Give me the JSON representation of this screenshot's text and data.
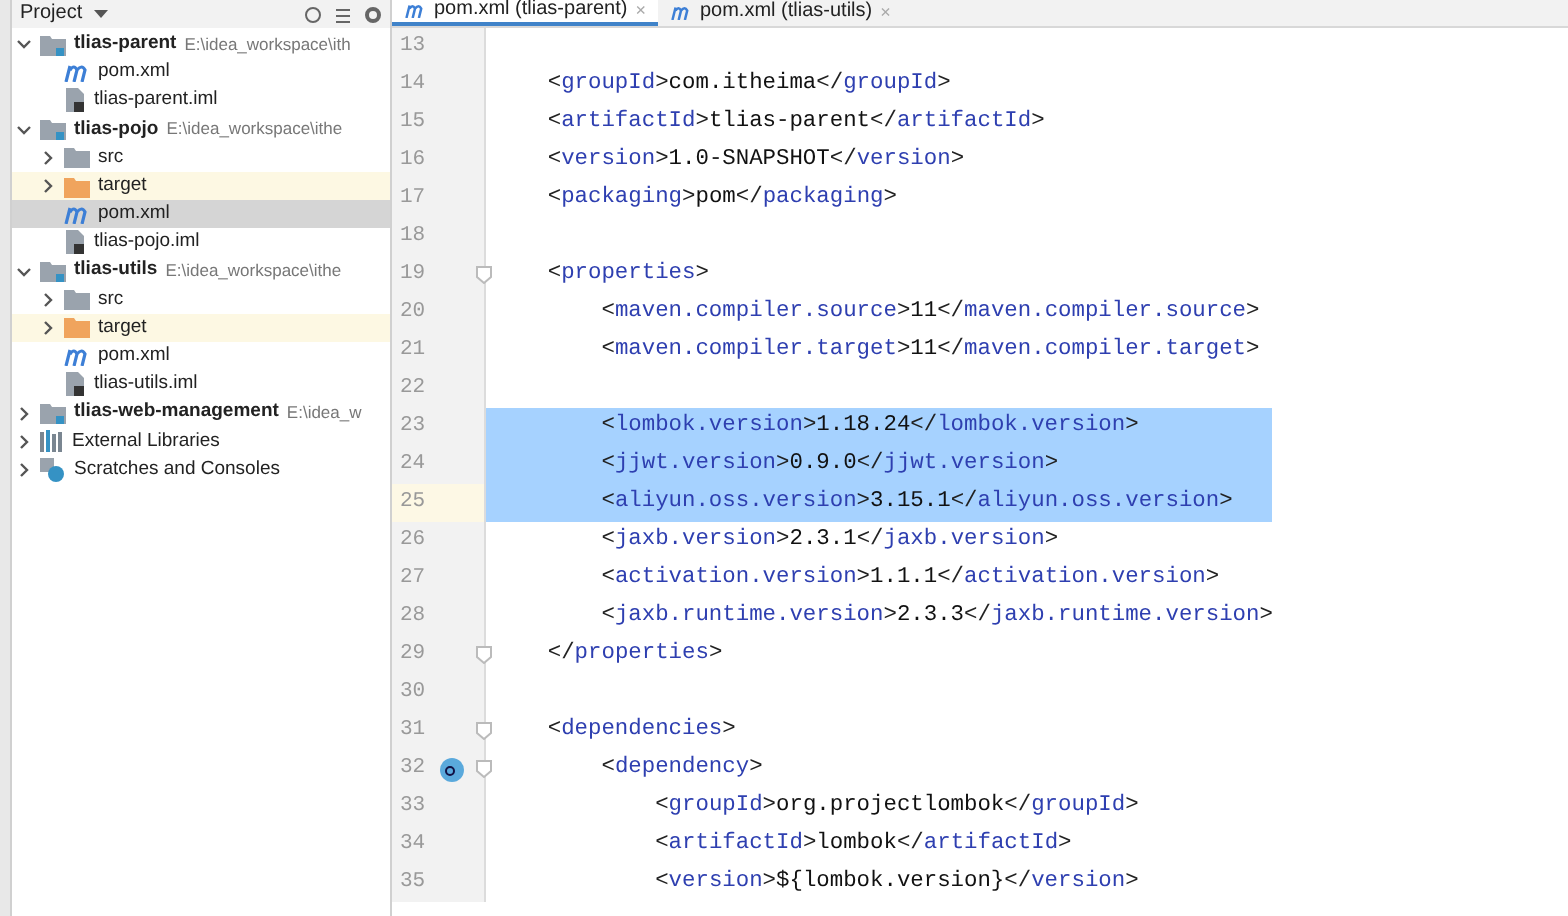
{
  "project_panel": {
    "title": "Project",
    "tree": [
      {
        "kind": "module",
        "label": "tlias-parent",
        "path": "E:\\idea_workspace\\ith",
        "expanded": true,
        "selected": false,
        "children": [
          {
            "kind": "pom",
            "label": "pom.xml",
            "selected": false
          },
          {
            "kind": "iml",
            "label": "tlias-parent.iml",
            "selected": false
          }
        ]
      },
      {
        "kind": "module",
        "label": "tlias-pojo",
        "path": "E:\\idea_workspace\\ithe",
        "expanded": true,
        "selected": false,
        "children": [
          {
            "kind": "folder",
            "label": "src",
            "expanded": false,
            "excluded": false,
            "selected": false
          },
          {
            "kind": "folder",
            "label": "target",
            "expanded": false,
            "excluded": true,
            "selected": false
          },
          {
            "kind": "pom",
            "label": "pom.xml",
            "selected": true
          },
          {
            "kind": "iml",
            "label": "tlias-pojo.iml",
            "selected": false
          }
        ]
      },
      {
        "kind": "module",
        "label": "tlias-utils",
        "path": "E:\\idea_workspace\\ithe",
        "expanded": true,
        "selected": false,
        "children": [
          {
            "kind": "folder",
            "label": "src",
            "expanded": false,
            "excluded": false,
            "selected": false
          },
          {
            "kind": "folder",
            "label": "target",
            "expanded": false,
            "excluded": true,
            "selected": false
          },
          {
            "kind": "pom",
            "label": "pom.xml",
            "selected": false
          },
          {
            "kind": "iml",
            "label": "tlias-utils.iml",
            "selected": false
          }
        ]
      },
      {
        "kind": "module",
        "label": "tlias-web-management",
        "path": "E:\\idea_w",
        "expanded": false,
        "selected": false
      },
      {
        "kind": "libraries",
        "label": "External Libraries",
        "expanded": false,
        "selected": false
      },
      {
        "kind": "scratches",
        "label": "Scratches and Consoles",
        "expanded": false,
        "selected": false
      }
    ]
  },
  "tabs": [
    {
      "label": "pom.xml (tlias-parent)",
      "close": "×",
      "selected": true
    },
    {
      "label": "pom.xml (tlias-utils)",
      "close": "×",
      "selected": false
    }
  ],
  "lines": [
    {
      "n": "13",
      "selected": false
    },
    {
      "n": "14",
      "text": "    <groupId>com.itheima</groupId>",
      "selected": false
    },
    {
      "n": "15",
      "text": "    <artifactId>tlias-parent</artifactId>",
      "selected": false
    },
    {
      "n": "16",
      "text": "    <version>1.0-SNAPSHOT</version>",
      "selected": false
    },
    {
      "n": "17",
      "text": "    <packaging>pom</packaging>",
      "selected": false
    },
    {
      "n": "18",
      "selected": false
    },
    {
      "n": "19",
      "text": "    <properties>",
      "selected": false,
      "fold": true
    },
    {
      "n": "20",
      "text": "        <maven.compiler.source>11</maven.compiler.source>",
      "selected": false
    },
    {
      "n": "21",
      "text": "        <maven.compiler.target>11</maven.compiler.target>",
      "selected": false
    },
    {
      "n": "22",
      "selected": false
    },
    {
      "n": "23",
      "text": "        <lombok.version>1.18.24</lombok.version>",
      "selected": true
    },
    {
      "n": "24",
      "text": "        <jjwt.version>0.9.0</jjwt.version>",
      "selected": true
    },
    {
      "n": "25",
      "text": "        <aliyun.oss.version>3.15.1</aliyun.oss.version>",
      "selected": true,
      "current": true
    },
    {
      "n": "26",
      "text": "        <jaxb.version>2.3.1</jaxb.version>",
      "selected": false
    },
    {
      "n": "27",
      "text": "        <activation.version>1.1.1</activation.version>",
      "selected": false
    },
    {
      "n": "28",
      "text": "        <jaxb.runtime.version>2.3.3</jaxb.runtime.version>",
      "selected": false
    },
    {
      "n": "29",
      "text": "    </properties>",
      "selected": false,
      "fold": true
    },
    {
      "n": "30",
      "selected": false
    },
    {
      "n": "31",
      "text": "    <dependencies>",
      "selected": false,
      "fold": true
    },
    {
      "n": "32",
      "text": "        <dependency>",
      "selected": false,
      "fold": true,
      "marker": true
    },
    {
      "n": "33",
      "text": "            <groupId>org.projectlombok</groupId>",
      "selected": false
    },
    {
      "n": "34",
      "text": "            <artifactId>lombok</artifactId>",
      "selected": false
    },
    {
      "n": "35",
      "text": "            <version>${lombok.version}</version>",
      "selected": false
    }
  ]
}
